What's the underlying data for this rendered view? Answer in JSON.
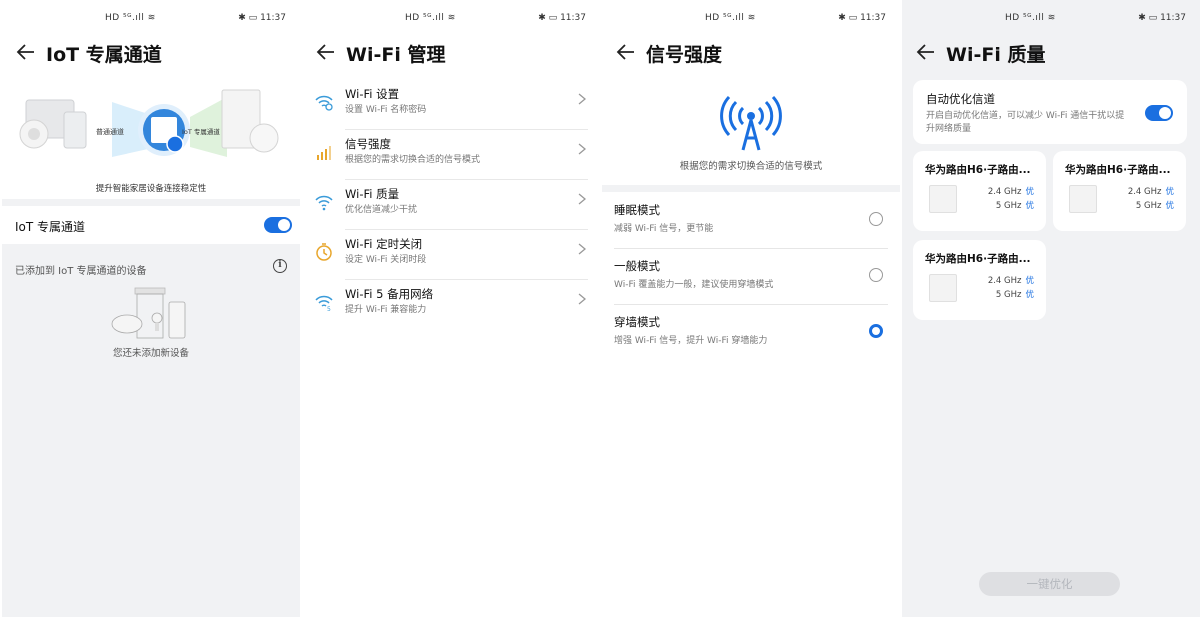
{
  "status": {
    "time": "11:37",
    "left_icons": "HD ⁵ᴳ.ıll ≋",
    "right_icons": "✱ ▭"
  },
  "screens": {
    "iot": {
      "title": "IoT 专属通道",
      "diagram_label_left": "普通通道",
      "diagram_label_right": "IoT 专属通道",
      "caption": "提升智能家居设备连接稳定性",
      "switch_label": "IoT 专属通道",
      "switch_on": true,
      "added_label": "已添加到 IoT 专属通道的设备",
      "empty_text": "您还未添加新设备"
    },
    "wifi_manage": {
      "title": "Wi-Fi 管理",
      "items": [
        {
          "title": "Wi-Fi 设置",
          "subtitle": "设置 Wi-Fi 名称密码",
          "icon": "wifi-settings-icon",
          "color": "#3a9bd9"
        },
        {
          "title": "信号强度",
          "subtitle": "根据您的需求切换合适的信号模式",
          "icon": "signal-bars-icon",
          "color": "#e8a62c"
        },
        {
          "title": "Wi-Fi 质量",
          "subtitle": "优化信道减少干扰",
          "icon": "wifi-quality-icon",
          "color": "#3a9bd9"
        },
        {
          "title": "Wi-Fi 定时关闭",
          "subtitle": "设定 Wi-Fi 关闭时段",
          "icon": "timer-icon",
          "color": "#e8a62c"
        },
        {
          "title": "Wi-Fi 5 备用网络",
          "subtitle": "提升 Wi-Fi 兼容能力",
          "icon": "wifi5-icon",
          "color": "#3a9bd9"
        }
      ]
    },
    "signal": {
      "title": "信号强度",
      "description": "根据您的需求切换合适的信号模式",
      "modes": [
        {
          "title": "睡眠模式",
          "subtitle": "减弱 Wi-Fi 信号，更节能",
          "selected": false
        },
        {
          "title": "一般模式",
          "subtitle": "Wi-Fi 覆盖能力一般，建议使用穿墙模式",
          "selected": false
        },
        {
          "title": "穿墙模式",
          "subtitle": "增强 Wi-Fi 信号，提升 Wi-Fi 穿墙能力",
          "selected": true
        }
      ]
    },
    "quality": {
      "title": "Wi-Fi 质量",
      "auto_title": "自动优化信道",
      "auto_desc": "开启自动优化信道，可以减少 Wi-Fi 通信干扰以提升网络质量",
      "auto_on": true,
      "routers": [
        {
          "name": "华为路由H6·子路由...",
          "band1": "2.4 GHz",
          "band1_q": "优",
          "band2": "5 GHz",
          "band2_q": "优"
        },
        {
          "name": "华为路由H6·子路由...",
          "band1": "2.4 GHz",
          "band1_q": "优",
          "band2": "5 GHz",
          "band2_q": "优"
        },
        {
          "name": "华为路由H6·子路由...",
          "band1": "2.4 GHz",
          "band1_q": "优",
          "band2": "5 GHz",
          "band2_q": "优"
        }
      ],
      "button": "一键优化"
    }
  },
  "colors": {
    "accent": "#1a6fe0",
    "bg": "#f1f2f4"
  }
}
